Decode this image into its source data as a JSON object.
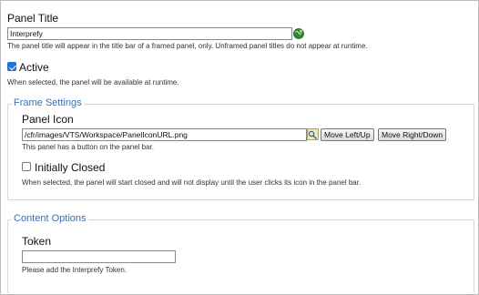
{
  "panel_title": {
    "label": "Panel Title",
    "value": "Interprefy",
    "help": "The panel title will appear in the title bar of a framed panel, only. Unframed panel titles do not appear at runtime.",
    "icon": "globe-preview-icon"
  },
  "active": {
    "label": "Active",
    "checked": true,
    "help": "When selected, the panel will be available at runtime."
  },
  "frame_settings": {
    "legend": "Frame Settings",
    "panel_icon": {
      "label": "Panel Icon",
      "value": "/cfr/images/VTS/Workspace/PanelIconURL.png",
      "browse_icon": "folder-browse-icon",
      "move_left_up": "Move Left/Up",
      "move_right_down": "Move Right/Down",
      "help": "This panel has a button on the panel bar."
    },
    "initially_closed": {
      "label": "Initially Closed",
      "checked": false,
      "help": "When selected, the panel will start closed and will not display until the user clicks its icon in the panel bar."
    }
  },
  "content_options": {
    "legend": "Content Options",
    "token": {
      "label": "Token",
      "value": "",
      "help": "Please add the Interprefy Token."
    }
  }
}
